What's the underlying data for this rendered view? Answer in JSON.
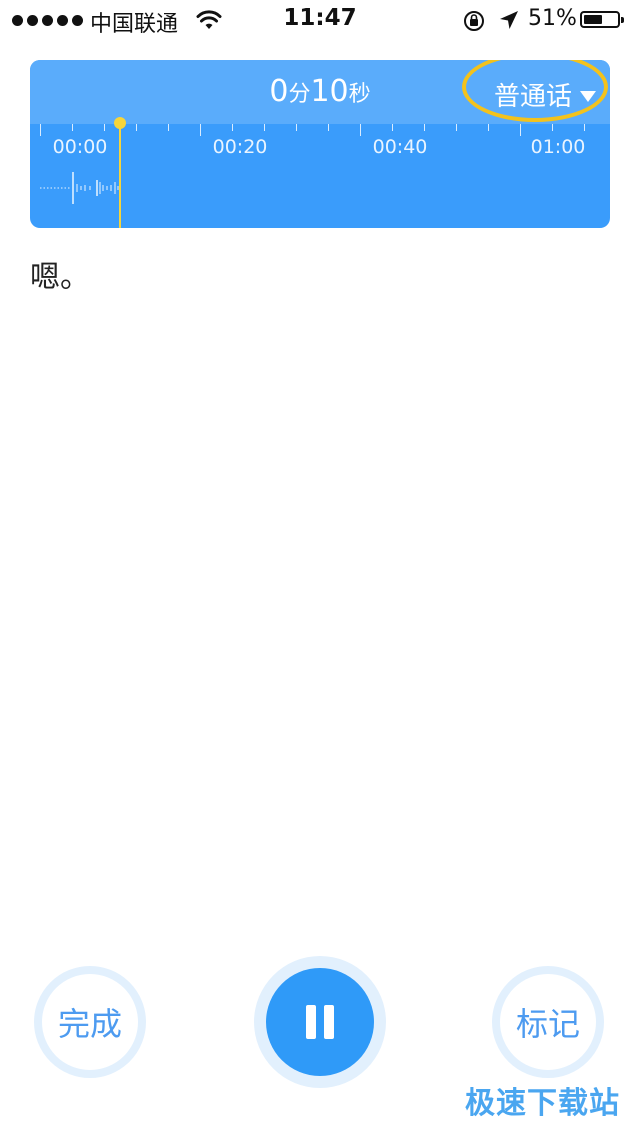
{
  "status_bar": {
    "carrier": "中国联通",
    "time": "11:47",
    "battery": "51%",
    "battery_level": 0.51,
    "icons": [
      "signal-dots",
      "wifi-icon",
      "rotation-lock-icon",
      "location-arrow-icon",
      "battery-icon"
    ]
  },
  "recorder": {
    "duration_minutes": "0",
    "minutes_unit": "分",
    "duration_seconds": "10",
    "seconds_unit": "秒",
    "language": "普通话",
    "timeline_labels": [
      "00:00",
      "00:20",
      "00:40",
      "01:00"
    ],
    "colors": {
      "panel": "#3a9cfb",
      "panel_header": "#5aacfb",
      "playhead": "#f6d53a",
      "highlight": "#f3c21c"
    }
  },
  "transcript": {
    "text": "嗯。"
  },
  "controls": {
    "done_label": "完成",
    "mark_label": "标记",
    "pause_icon": "pause-icon",
    "accent_color": "#2f9af8"
  },
  "watermark": "极速下载站"
}
